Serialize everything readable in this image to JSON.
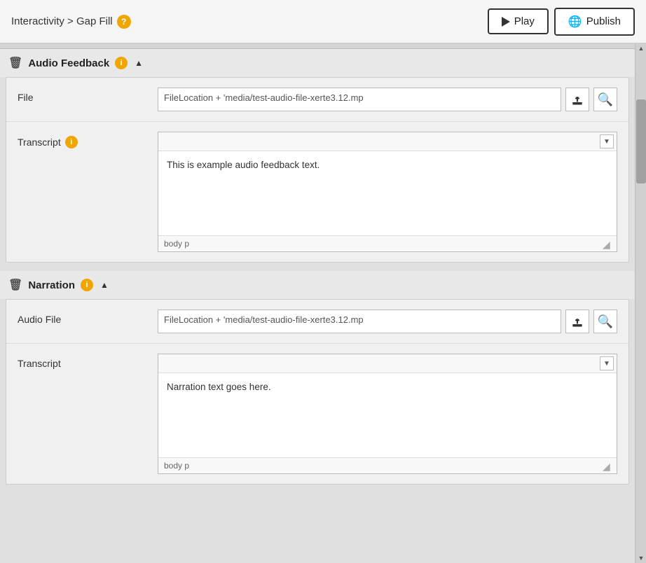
{
  "header": {
    "breadcrumb": "Interactivity > Gap Fill",
    "help_tooltip": "?",
    "play_label": "Play",
    "publish_label": "Publish"
  },
  "sections": [
    {
      "id": "audio-feedback",
      "title": "Audio Feedback",
      "fields": [
        {
          "id": "af-file",
          "label": "File",
          "type": "file",
          "value": "FileLocation + 'media/test-audio-file-xerte3.12.mp"
        },
        {
          "id": "af-transcript",
          "label": "Transcript",
          "has_info": true,
          "type": "richtext",
          "value": "This is example audio feedback text.",
          "footer": "body  p"
        }
      ]
    },
    {
      "id": "narration",
      "title": "Narration",
      "fields": [
        {
          "id": "n-file",
          "label": "Audio File",
          "type": "file",
          "value": "FileLocation + 'media/test-audio-file-xerte3.12.mp"
        },
        {
          "id": "n-transcript",
          "label": "Transcript",
          "has_info": false,
          "type": "richtext",
          "value": "Narration text goes here.",
          "footer": "body  p"
        }
      ]
    }
  ],
  "icons": {
    "trash": "🗑",
    "info": "i",
    "collapse_up": "▲",
    "scrollbar_up": "▲",
    "scrollbar_down": "▼",
    "dropdown": "▼",
    "resize": "◢",
    "search": "🔍",
    "help": "?"
  },
  "colors": {
    "orange": "#f0a500",
    "border": "#bbb",
    "bg": "#e0e0e0"
  }
}
